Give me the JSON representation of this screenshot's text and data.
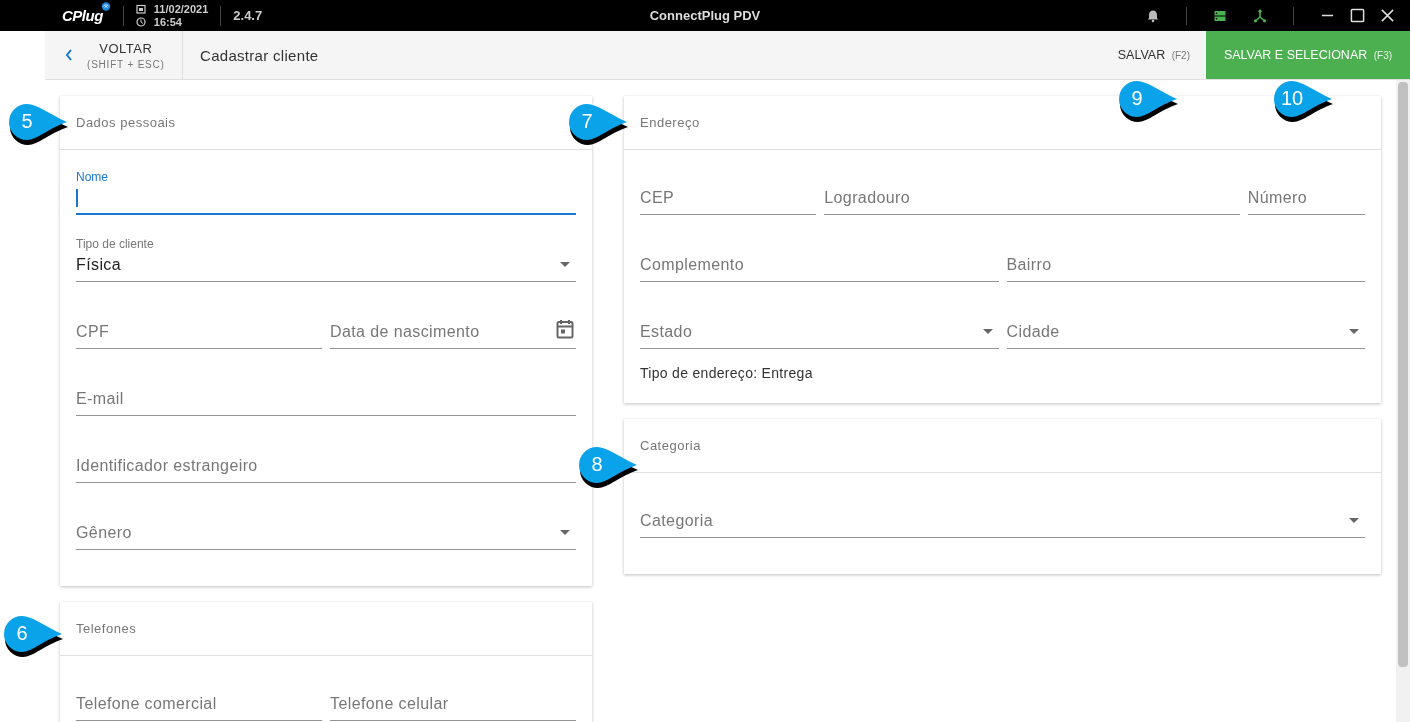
{
  "titlebar": {
    "logo": "CPlug",
    "date": "11/02/2021",
    "time": "16:54",
    "version": "2.4.7",
    "title": "ConnectPlug PDV"
  },
  "header": {
    "back_label": "VOLTAR",
    "back_shortcut": "(SHIFT + ESC)",
    "title": "Cadastrar cliente",
    "buttons": [
      {
        "label": "SALVAR",
        "shortcut": "(F2)",
        "kind": "flat"
      },
      {
        "label": "SALVAR E SELECIONAR",
        "shortcut": "(F3)",
        "kind": "primary"
      }
    ]
  },
  "columns": [
    {
      "cards": [
        {
          "title": "Dados pessoais",
          "rows": [
            [
              {
                "label": "Nome",
                "kind": "text",
                "focused": true
              }
            ],
            [
              {
                "label": "Tipo de cliente",
                "kind": "select",
                "value": "Física",
                "focused": false
              }
            ],
            [
              {
                "label": "CPF",
                "kind": "text",
                "focused": false
              },
              {
                "label": "Data de nascimento",
                "kind": "date",
                "focused": false
              }
            ],
            [
              {
                "label": "E-mail",
                "kind": "text",
                "focused": false
              }
            ],
            [
              {
                "label": "Identificador estrangeiro",
                "kind": "text",
                "focused": false
              }
            ],
            [
              {
                "label": "Gênero",
                "kind": "select",
                "focused": false
              }
            ]
          ]
        },
        {
          "title": "Telefones",
          "rows": [
            [
              {
                "label": "Telefone comercial",
                "kind": "text",
                "focused": false
              },
              {
                "label": "Telefone celular",
                "kind": "text",
                "focused": false
              }
            ]
          ]
        }
      ]
    },
    {
      "cards": [
        {
          "title": "Endereço",
          "rows": [
            [
              {
                "label": "CEP",
                "kind": "text",
                "focused": false
              },
              {
                "label": "Logradouro",
                "kind": "text",
                "focused": false
              },
              {
                "label": "Número",
                "kind": "text",
                "focused": false
              }
            ],
            [
              {
                "label": "Complemento",
                "kind": "text",
                "focused": false
              },
              {
                "label": "Bairro",
                "kind": "text",
                "focused": false
              }
            ],
            [
              {
                "label": "Estado",
                "kind": "select",
                "focused": false
              },
              {
                "label": "Cidade",
                "kind": "select",
                "focused": false
              }
            ]
          ],
          "note": "Tipo de endereço: Entrega"
        },
        {
          "title": "Categoria",
          "rows": [
            [
              {
                "label": "Categoria",
                "kind": "select",
                "focused": false
              }
            ]
          ]
        }
      ]
    }
  ],
  "callouts": [
    "5",
    "6",
    "7",
    "8",
    "9",
    "10"
  ]
}
